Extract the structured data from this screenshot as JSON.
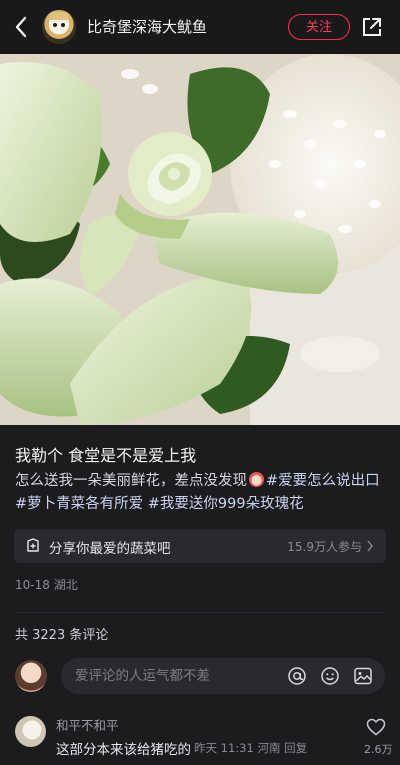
{
  "header": {
    "username": "比奇堡深海大鱿鱼",
    "follow_label": "关注"
  },
  "post": {
    "title": "我勒个 食堂是不是爱上我",
    "desc_text": "怎么送我一朵美丽鲜花，差点没发现",
    "tags": [
      "#爱要怎么说出口",
      "#萝卜青菜各有所爱",
      "#我要送你999朵玫瑰花"
    ],
    "topic": {
      "label": "分享你最爱的蔬菜吧",
      "count": "15.9万人参与"
    },
    "date": "10-18",
    "location": "湖北"
  },
  "comments": {
    "total_label": "共 3223 条评论",
    "input_placeholder": "爱评论的人运气都不差",
    "items": [
      {
        "name": "和平不和平",
        "text": "这部分本来该给猪吃的",
        "meta": "昨天 11:31 河南 回复",
        "likes": "2.6万"
      }
    ]
  },
  "colors": {
    "background": "#1c1c1e",
    "accent": "#ff2e4d"
  }
}
